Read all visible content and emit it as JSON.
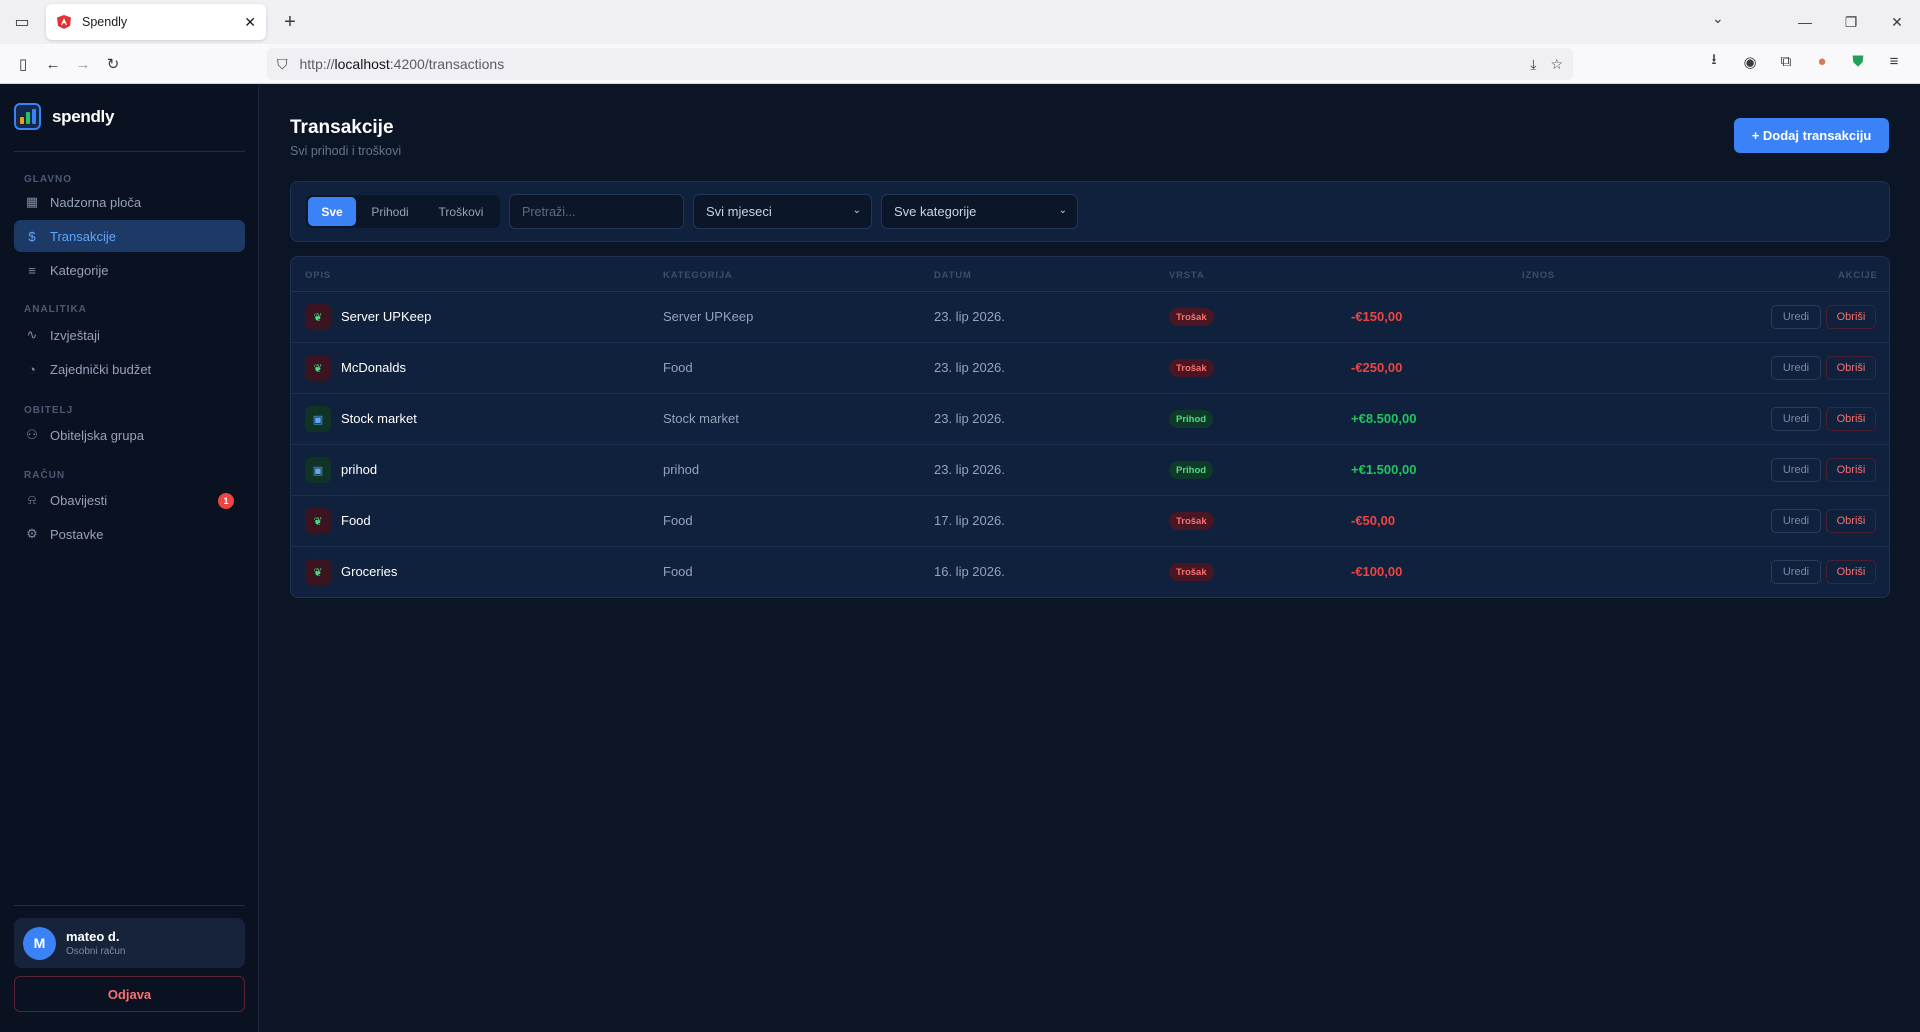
{
  "browser": {
    "tab_title": "Spendly",
    "url_prefix": "http://",
    "url_host": "localhost",
    "url_path": ":4200/transactions"
  },
  "sidebar": {
    "brand": "spendly",
    "sections": {
      "main": "GLAVNO",
      "analytics": "ANALITIKA",
      "family": "OBITELJ",
      "account": "RAČUN"
    },
    "items": {
      "dashboard": "Nadzorna ploča",
      "transactions": "Transakcije",
      "categories": "Kategorije",
      "reports": "Izvještaji",
      "shared_budget": "Zajednički budžet",
      "family_group": "Obiteljska grupa",
      "notifications": "Obavijesti",
      "settings": "Postavke"
    },
    "notifications_badge": "1",
    "user": {
      "initial": "M",
      "name": "mateo d.",
      "account_type": "Osobni račun"
    },
    "logout": "Odjava"
  },
  "main": {
    "title": "Transakcije",
    "subtitle": "Svi prihodi i troškovi",
    "add_button": "+ Dodaj transakciju",
    "filters": {
      "tabs": [
        "Sve",
        "Prihodi",
        "Troškovi"
      ],
      "search_placeholder": "Pretraži...",
      "month_select": "Svi mjeseci",
      "category_select": "Sve kategorije"
    },
    "table": {
      "headers": [
        "OPIS",
        "KATEGORIJA",
        "DATUM",
        "VRSTA",
        "IZNOS",
        "AKCIJE"
      ],
      "edit_label": "Uredi",
      "delete_label": "Obriši",
      "rows": [
        {
          "desc": "Server UPKeep",
          "category": "Server UPKeep",
          "date": "23. lip 2026.",
          "type": "Trošak",
          "amount": "-€150,00",
          "kind": "exp"
        },
        {
          "desc": "McDonalds",
          "category": "Food",
          "date": "23. lip 2026.",
          "type": "Trošak",
          "amount": "-€250,00",
          "kind": "exp"
        },
        {
          "desc": "Stock market",
          "category": "Stock market",
          "date": "23. lip 2026.",
          "type": "Prihod",
          "amount": "+€8.500,00",
          "kind": "inc"
        },
        {
          "desc": "prihod",
          "category": "prihod",
          "date": "23. lip 2026.",
          "type": "Prihod",
          "amount": "+€1.500,00",
          "kind": "inc"
        },
        {
          "desc": "Food",
          "category": "Food",
          "date": "17. lip 2026.",
          "type": "Trošak",
          "amount": "-€50,00",
          "kind": "exp"
        },
        {
          "desc": "Groceries",
          "category": "Food",
          "date": "16. lip 2026.",
          "type": "Trošak",
          "amount": "-€100,00",
          "kind": "exp"
        }
      ]
    }
  },
  "colors": {
    "accent": "#3b82f6",
    "expense": "#ef4444",
    "income": "#22c55e",
    "background": "#0c1526",
    "sidebar": "#0a1221"
  }
}
